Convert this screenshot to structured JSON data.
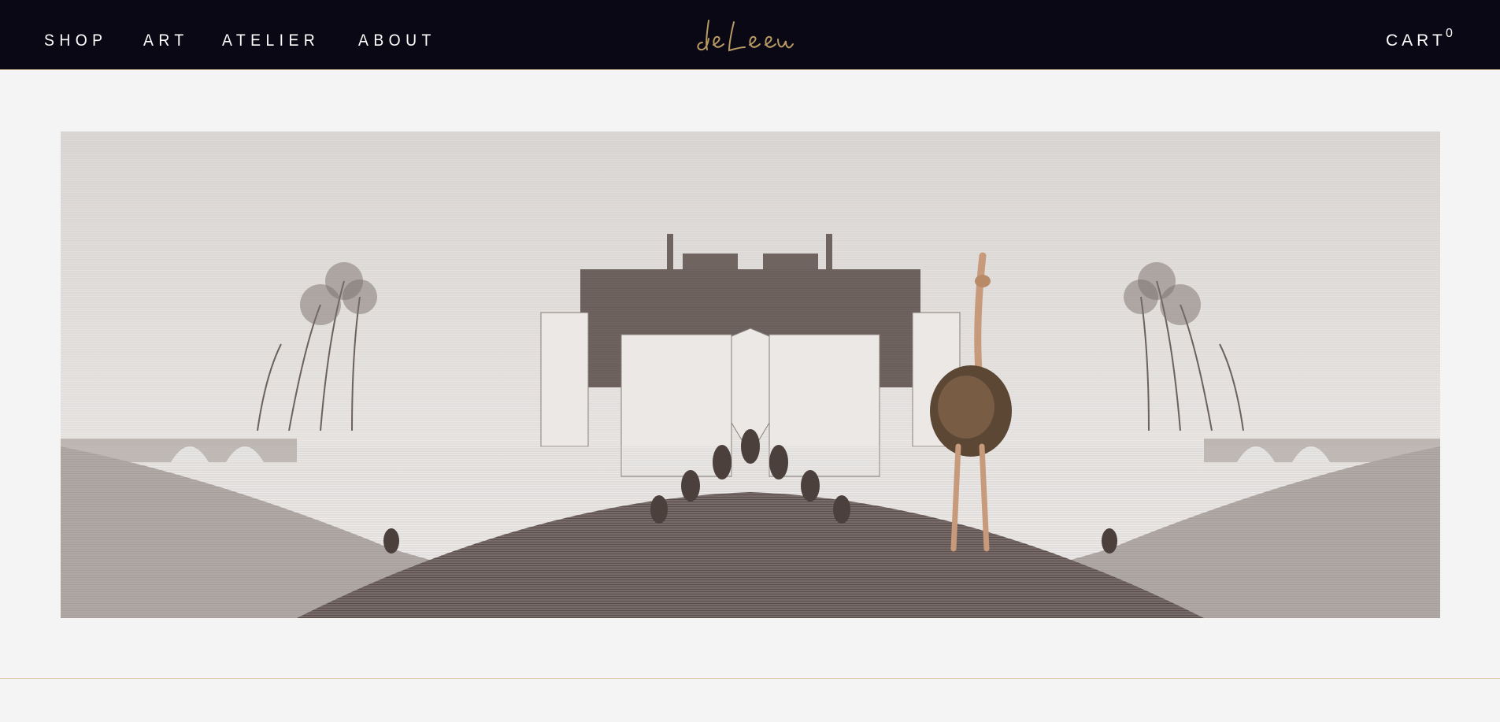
{
  "nav": {
    "items": [
      {
        "label": "SHOP"
      },
      {
        "label": "ART"
      },
      {
        "label": "ATELIER"
      },
      {
        "label": "ABOUT"
      }
    ]
  },
  "brand": {
    "logo_text": "de Leeuw",
    "logo_color": "#b89a63"
  },
  "cart": {
    "label": "CART",
    "count": "0"
  },
  "hero": {
    "image_icon": "engraving-artwork-image"
  },
  "colors": {
    "header_bg": "#0b0816",
    "page_bg": "#f4f4f4",
    "accent_gold": "#c8b48a"
  }
}
